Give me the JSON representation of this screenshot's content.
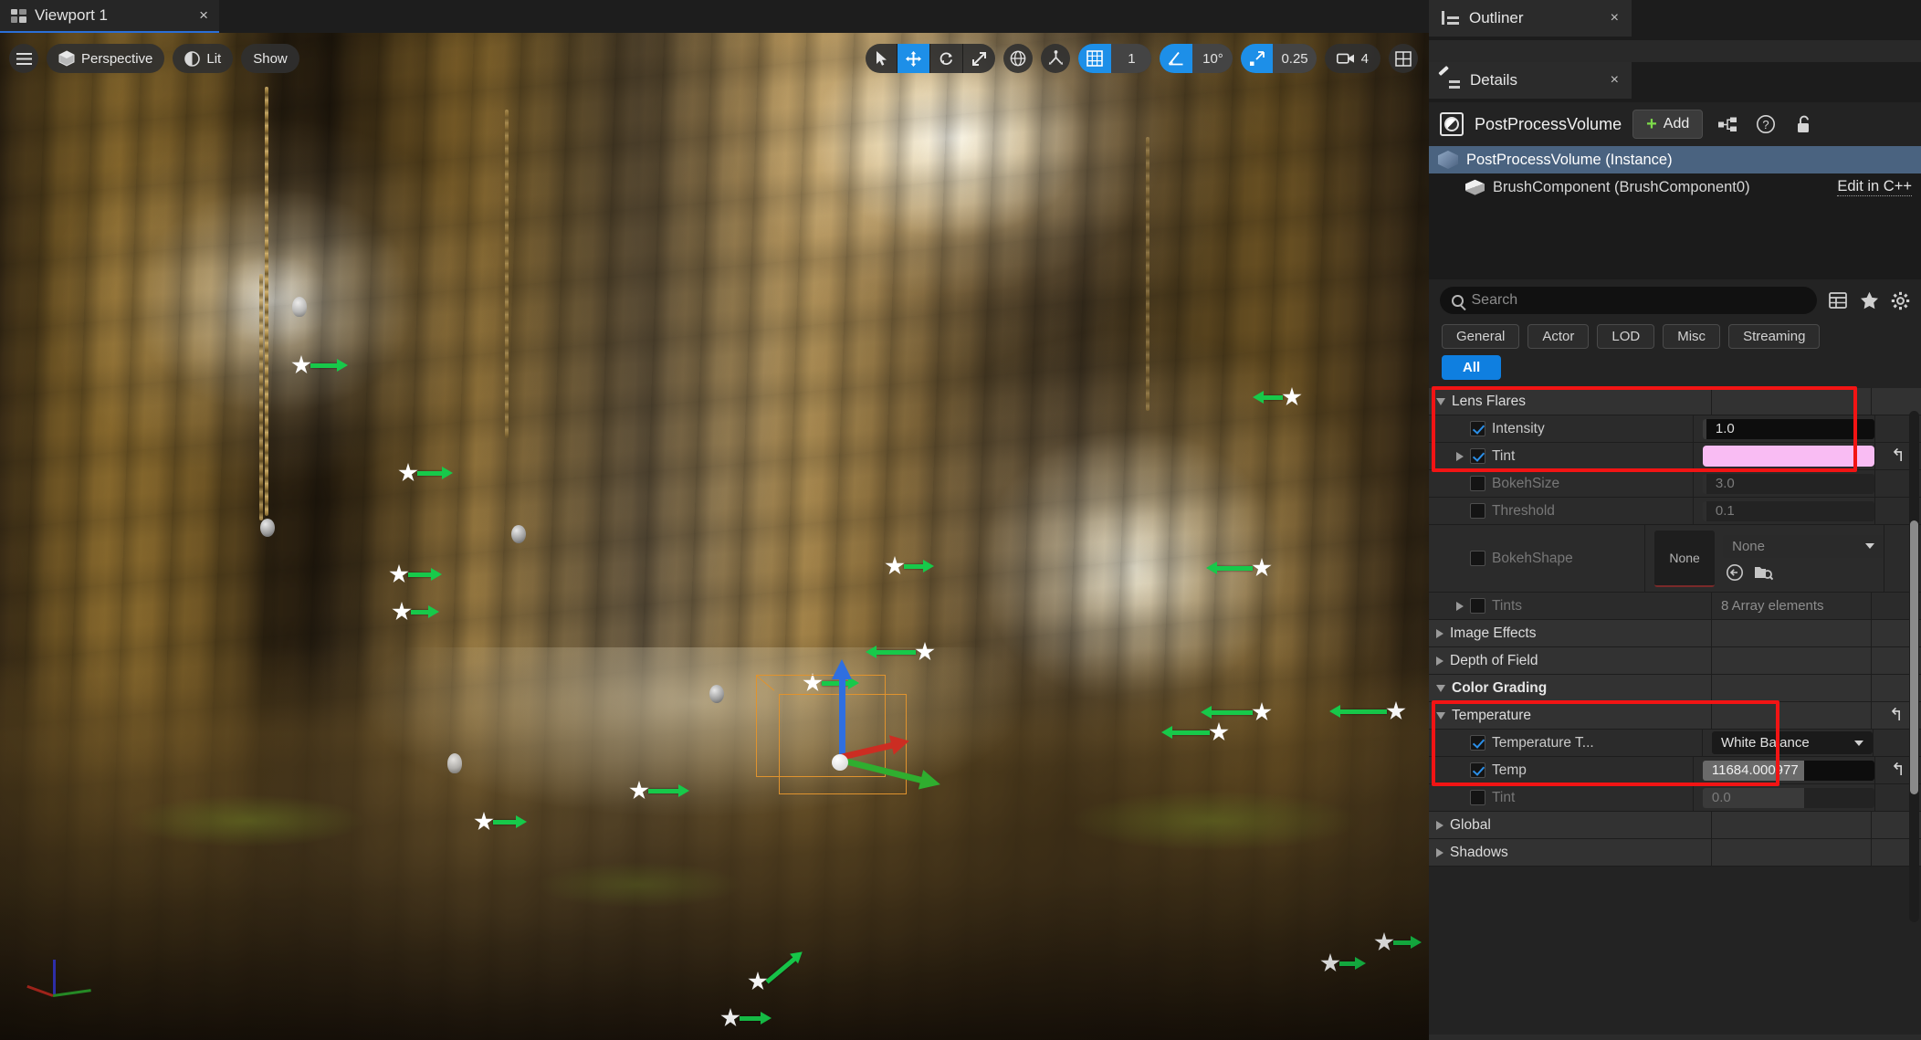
{
  "viewport": {
    "tab": {
      "label": "Viewport 1",
      "close": "×",
      "icon": "viewport-grid-icon"
    },
    "toolbar_left": [
      {
        "name": "menu",
        "label": "",
        "icon": "hamburger-icon"
      },
      {
        "name": "camera-mode",
        "label": "Perspective",
        "icon": "cube-icon"
      },
      {
        "name": "view-mode",
        "label": "Lit",
        "icon": "lit-sphere-icon"
      },
      {
        "name": "show-menu",
        "label": "Show",
        "icon": ""
      }
    ],
    "transform_tools": [
      {
        "name": "select",
        "icon": "cursor-arrow-icon",
        "active": false
      },
      {
        "name": "translate",
        "icon": "move-arrows-icon",
        "active": true
      },
      {
        "name": "rotate",
        "icon": "rotate-icon",
        "active": false
      },
      {
        "name": "scale",
        "icon": "scale-icon",
        "active": false
      }
    ],
    "coord_system": {
      "name": "world-space-toggle",
      "icon": "globe-icon"
    },
    "surface_snap": {
      "name": "surface-snap-toggle",
      "icon": "surface-snap-icon"
    },
    "grid_snap": {
      "icon": "grid-icon",
      "value": "1",
      "active": true
    },
    "angle_snap": {
      "icon": "angle-icon",
      "value": "10°",
      "active": true
    },
    "scale_snap": {
      "icon": "scale-snap-icon",
      "value": "0.25",
      "active": true
    },
    "camera_speed": {
      "icon": "camera-icon",
      "value": "4"
    },
    "layout_button": {
      "icon": "viewport-layout-icon"
    }
  },
  "outliner": {
    "title": "Outliner",
    "close": "×",
    "icon": "outliner-icon"
  },
  "details": {
    "title": "Details",
    "close": "×",
    "icon": "details-pencil-icon",
    "actor_name": "PostProcessVolume",
    "actor_icon": "postprocess-volume-icon",
    "add_button": "Add",
    "add_plus": "+",
    "header_icons": [
      "blueprint-icon",
      "help-icon",
      "unlock-icon"
    ],
    "components": [
      {
        "label": "PostProcessVolume (Instance)",
        "icon": "volume-cube-icon",
        "selected": true
      },
      {
        "label": "BrushComponent (BrushComponent0)",
        "icon": "brush-cube-icon",
        "selected": false,
        "action": "Edit in C++"
      }
    ],
    "search": {
      "placeholder": "Search",
      "value": "",
      "icon": "search-icon"
    },
    "search_icons": [
      "column-settings-icon",
      "favorites-star-icon",
      "settings-gear-icon"
    ],
    "filters": [
      "General",
      "Actor",
      "LOD",
      "Misc",
      "Streaming"
    ],
    "filter_all": "All",
    "properties": [
      {
        "id": "lens-flares",
        "label": "Lens Flares",
        "type": "category",
        "expanded": true,
        "highlighted": true,
        "rows": [
          {
            "id": "intensity",
            "label": "Intensity",
            "checked": true,
            "enabled": true,
            "control": "number",
            "value": "1.0",
            "expandable": false,
            "revert": false
          },
          {
            "id": "tint",
            "label": "Tint",
            "checked": true,
            "enabled": true,
            "control": "color",
            "value": "#f9bcf3",
            "expandable": true,
            "revert": true
          },
          {
            "id": "bokeh-size",
            "label": "BokehSize",
            "checked": false,
            "enabled": false,
            "control": "number",
            "value": "3.0",
            "expandable": false,
            "revert": false
          },
          {
            "id": "threshold",
            "label": "Threshold",
            "checked": false,
            "enabled": false,
            "control": "number",
            "value": "0.1",
            "expandable": false,
            "revert": false
          },
          {
            "id": "bokeh-shape",
            "label": "BokehShape",
            "checked": false,
            "enabled": false,
            "control": "asset",
            "value": "None",
            "thumb": "None",
            "expandable": false,
            "revert": false
          },
          {
            "id": "tints",
            "label": "Tints",
            "checked": false,
            "enabled": false,
            "control": "array",
            "value": "8 Array elements",
            "expandable": true,
            "revert": false
          }
        ]
      },
      {
        "id": "image-effects",
        "label": "Image Effects",
        "type": "category",
        "expanded": false,
        "highlighted": false,
        "rows": []
      },
      {
        "id": "depth-of-field",
        "label": "Depth of Field",
        "type": "category",
        "expanded": false,
        "highlighted": false,
        "rows": []
      },
      {
        "id": "color-grading",
        "label": "Color Grading",
        "type": "category-bold",
        "expanded": true,
        "highlighted": false,
        "rows": []
      },
      {
        "id": "temperature",
        "label": "Temperature",
        "type": "subcategory",
        "expanded": true,
        "highlighted": true,
        "revert": true,
        "rows": [
          {
            "id": "temperature-type",
            "label": "Temperature T...",
            "checked": true,
            "enabled": true,
            "control": "combo",
            "value": "White Balance",
            "expandable": false,
            "revert": false
          },
          {
            "id": "temp",
            "label": "Temp",
            "checked": true,
            "enabled": true,
            "control": "slider",
            "value": "11684.000977",
            "expandable": false,
            "revert": true
          },
          {
            "id": "wb-tint",
            "label": "Tint",
            "checked": false,
            "enabled": false,
            "control": "slider",
            "value": "0.0",
            "expandable": false,
            "revert": false
          }
        ]
      },
      {
        "id": "global",
        "label": "Global",
        "type": "category",
        "expanded": false,
        "highlighted": false,
        "rows": []
      },
      {
        "id": "shadows",
        "label": "Shadows",
        "type": "category",
        "expanded": false,
        "highlighted": false,
        "rows": []
      }
    ]
  },
  "colors": {
    "accent_blue": "#0f7fe0",
    "highlight_red": "#f21414",
    "tint_pink": "#f9bcf3",
    "selection_row": "#4a6380",
    "panel_bg": "#232323"
  }
}
